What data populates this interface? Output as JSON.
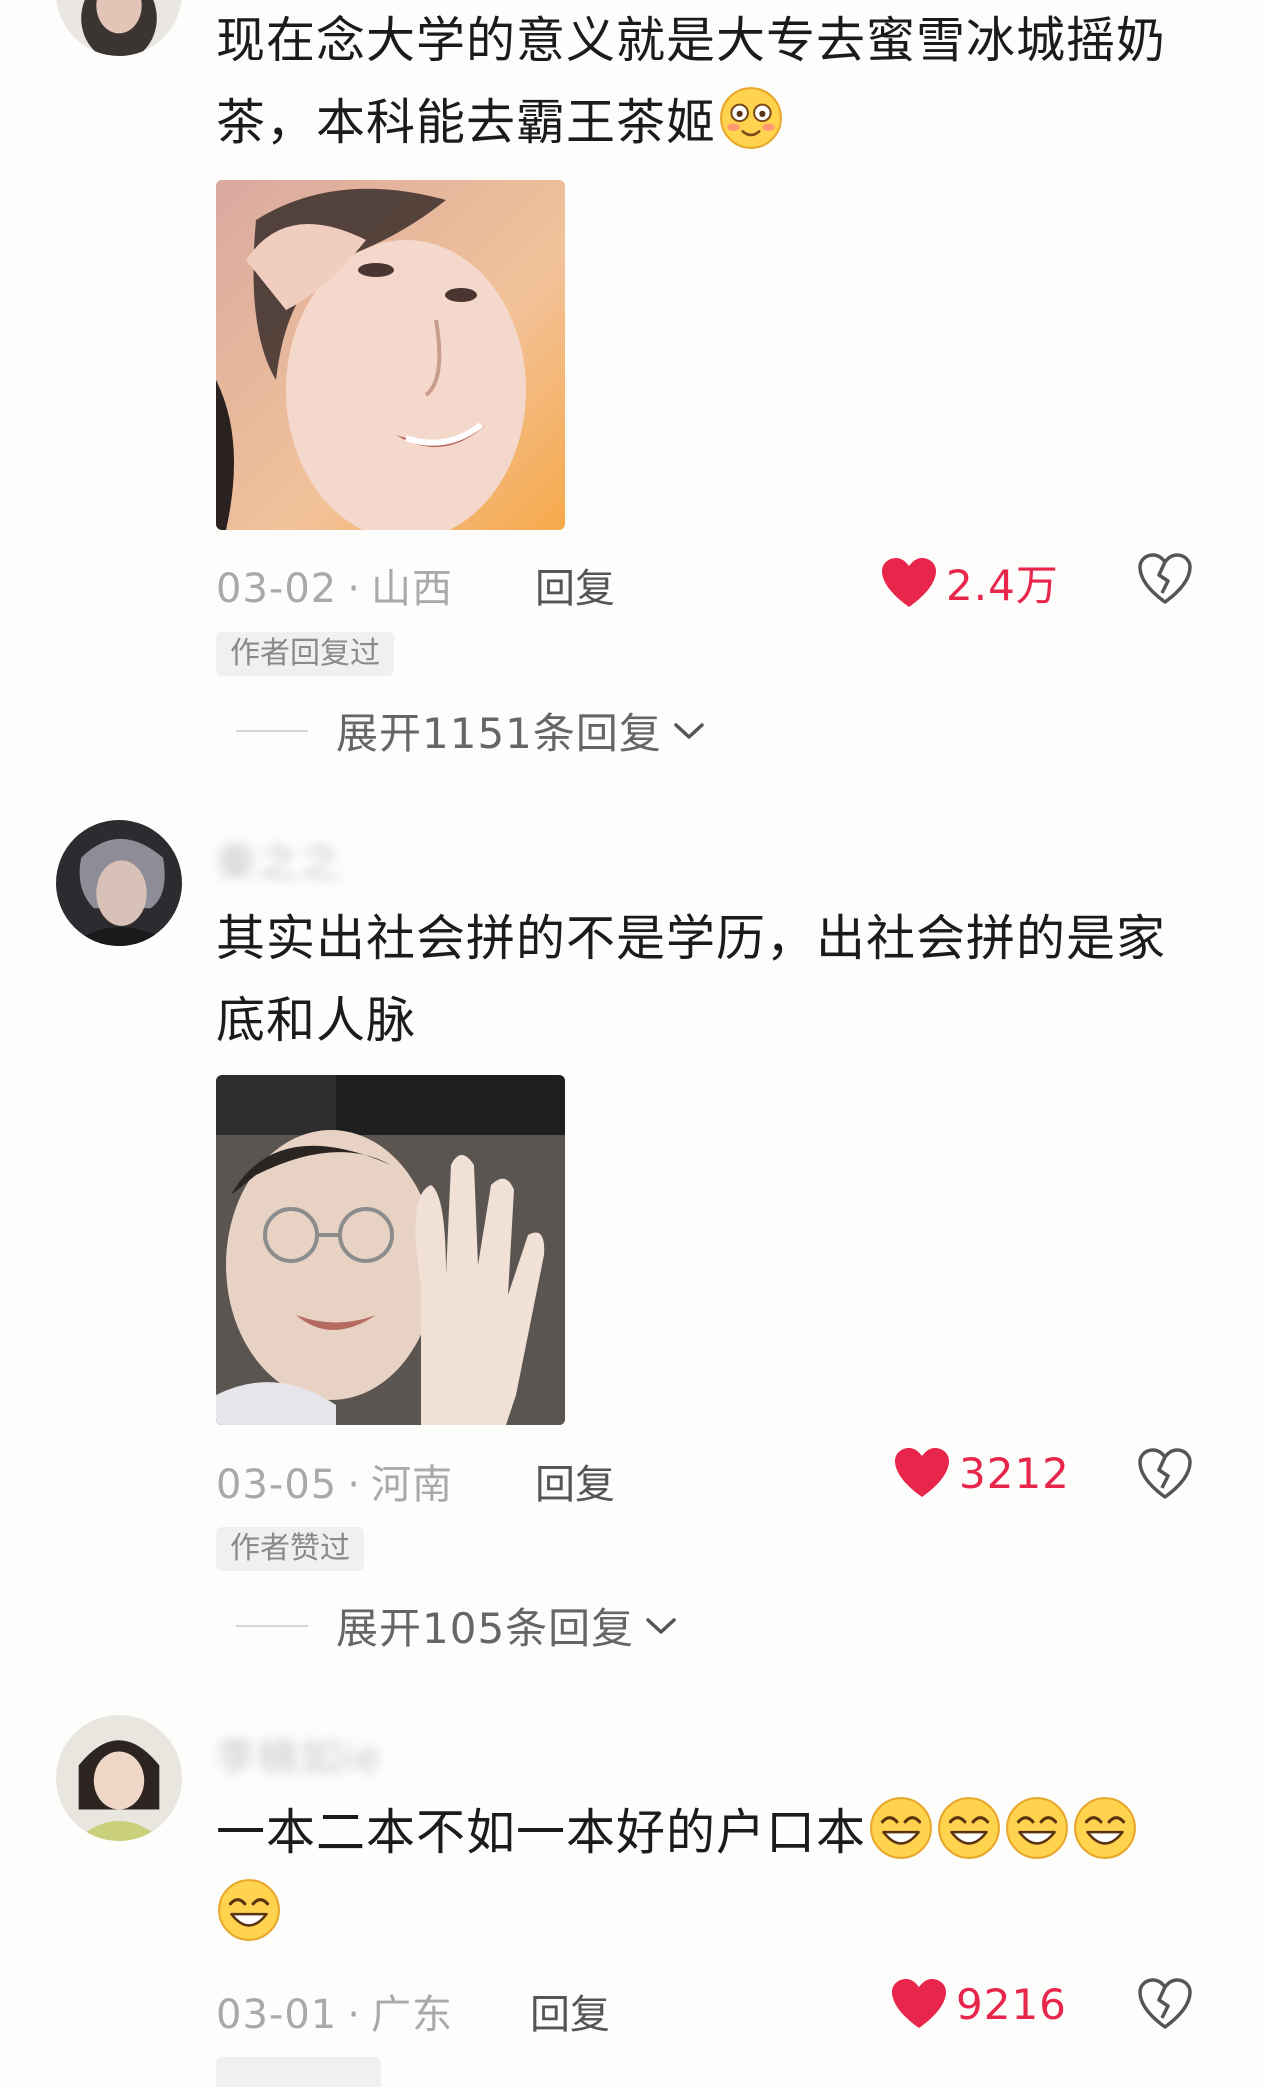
{
  "comments": [
    {
      "username": "",
      "text_line1": "现在念大学的意义就是大专去蜜雪冰城摇奶",
      "text_line2": "茶，本科能去霸王茶姬",
      "date": "03-02",
      "separator": "·",
      "location": "山西",
      "reply_label": "回复",
      "like_count": "2.4万",
      "badge": "作者回复过",
      "expand_label": "展开1151条回复",
      "emoji": "blushing-smile-emoji"
    },
    {
      "username": "秦之之",
      "text_line1": "其实出社会拼的不是学历，出社会拼的是家",
      "text_line2": "底和人脉",
      "date": "03-05",
      "separator": "·",
      "location": "河南",
      "reply_label": "回复",
      "like_count": "3212",
      "badge": "作者赞过",
      "expand_label": "展开105条回复"
    },
    {
      "username": "李楠如ie",
      "text_line1": "一本二本不如一本好的户口本",
      "date": "03-01",
      "separator": "·",
      "location": "广东",
      "reply_label": "回复",
      "like_count": "9216",
      "emoji": "grinning-squint-emoji"
    }
  ],
  "colors": {
    "like_red": "#e8254b",
    "meta_gray": "#a9a9a9",
    "badge_bg": "#f0f0f0"
  }
}
